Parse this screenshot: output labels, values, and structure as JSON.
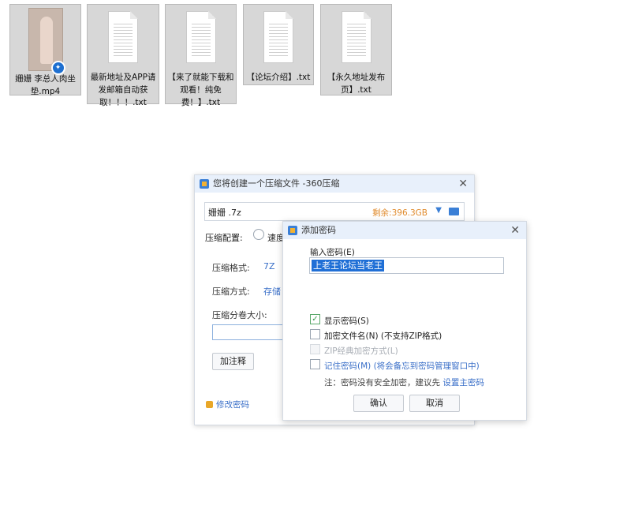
{
  "files": [
    {
      "name": "姗姗 李总人肉坐垫.mp4",
      "type": "video"
    },
    {
      "name": "最新地址及APP请发邮箱自动获取！！！.txt",
      "type": "txt"
    },
    {
      "name": "【来了就能下载和观看！纯免费！】.txt",
      "type": "txt"
    },
    {
      "name": "【论坛介绍】.txt",
      "type": "txt"
    },
    {
      "name": "【永久地址发布页】.txt",
      "type": "txt"
    }
  ],
  "compress_window": {
    "title": "您将创建一个压缩文件 -360压缩",
    "filename": "姗姗 .7z",
    "free_space": "剩余:396.3GB",
    "config_label": "压缩配置:",
    "speed_label": "速度",
    "format_label": "压缩格式:",
    "format_value": "7Z",
    "method_label": "压缩方式:",
    "method_value": "存储",
    "volume_label": "压缩分卷大小:",
    "comment_button": "加注释",
    "change_password": "修改密码"
  },
  "password_dialog": {
    "title": "添加密码",
    "input_label": "输入密码(E)",
    "password_value": "上老王论坛当老王",
    "show_password": "显示密码(S)",
    "encrypt_filenames": "加密文件名(N) (不支持ZIP格式)",
    "zip_classic": "ZIP经典加密方式(L)",
    "remember_password": "记住密码(M) (将会备忘到密码管理窗口中)",
    "note_prefix": "注：密码没有安全加密，建议先 ",
    "note_link": "设置主密码",
    "ok_button": "确认",
    "cancel_button": "取消"
  }
}
